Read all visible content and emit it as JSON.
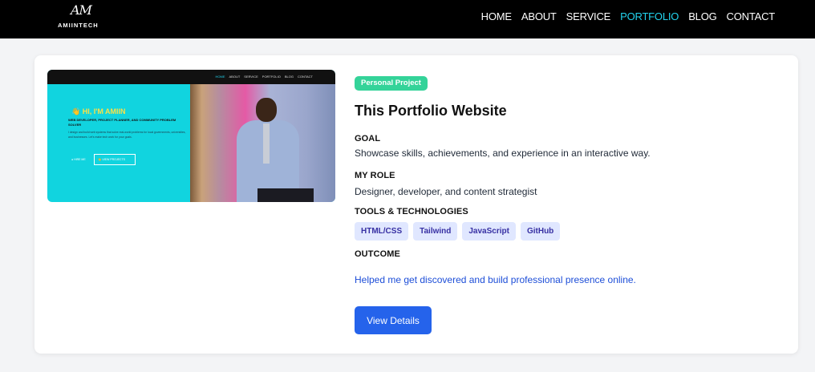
{
  "header": {
    "logo_mark": "AM",
    "logo_text": "AMIINTECH",
    "nav": [
      {
        "label": "HOME",
        "active": false
      },
      {
        "label": "ABOUT",
        "active": false
      },
      {
        "label": "SERVICE",
        "active": false
      },
      {
        "label": "PORTFOLIO",
        "active": true
      },
      {
        "label": "BLOG",
        "active": false
      },
      {
        "label": "CONTACT",
        "active": false
      }
    ]
  },
  "project": {
    "thumbnail": {
      "nav": [
        "HOME",
        "ABOUT",
        "SERVICE",
        "PORTFOLIO",
        "BLOG",
        "CONTACT"
      ],
      "greeting": "👋 HI, I'M AMIIN",
      "subtitle": "WEB DEVELOPER, PROJECT PLANNER, AND COMMUNITY PROBLEM SOLVER",
      "paragraph": "I design and build web systems that solve real-world problems for local governments, universities, and businesses. Let's make tech work for your goals.",
      "btn_1": "● HIRE ME",
      "btn_2": "👋 VIEW PROJECTS"
    },
    "badge": "Personal Project",
    "title": "This Portfolio Website",
    "goal_label": "GOAL",
    "goal_text": "Showcase skills, achievements, and experience in an interactive way.",
    "role_label": "MY ROLE",
    "role_text": "Designer, developer, and content strategist",
    "tools_label": "TOOLS & TECHNOLOGIES",
    "tools": [
      "HTML/CSS",
      "Tailwind",
      "JavaScript",
      "GitHub"
    ],
    "outcome_label": "OUTCOME",
    "outcome_text": "Helped me get discovered and build professional presence online.",
    "button_label": "View Details"
  },
  "colors": {
    "header_bg": "#000000",
    "nav_active": "#22d3ee",
    "badge_bg": "#34d399",
    "tag_bg": "#e0e7ff",
    "tag_text": "#3730a3",
    "link": "#1d4ed8",
    "button_bg": "#2563eb"
  }
}
